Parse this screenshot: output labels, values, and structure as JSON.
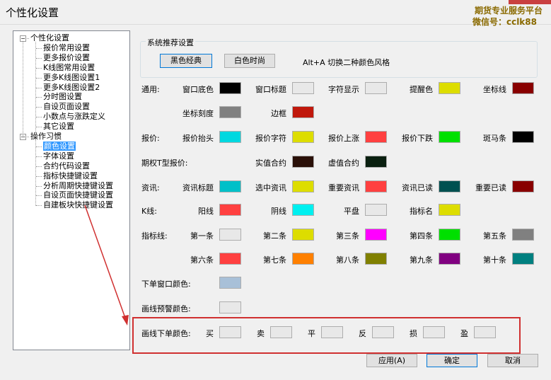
{
  "window": {
    "title": "个性化设置",
    "brand_line1": "期货专业服务平台",
    "brand_line2": "微信号：cclk88"
  },
  "tree": [
    {
      "label": "个性化设置",
      "level": 0
    },
    {
      "label": "报价常用设置",
      "level": 1
    },
    {
      "label": "更多报价设置",
      "level": 1
    },
    {
      "label": "K线图常用设置",
      "level": 1
    },
    {
      "label": "更多K线图设置1",
      "level": 1
    },
    {
      "label": "更多K线图设置2",
      "level": 1
    },
    {
      "label": "分时图设置",
      "level": 1
    },
    {
      "label": "自设页面设置",
      "level": 1
    },
    {
      "label": "小数点与涨跌定义",
      "level": 1
    },
    {
      "label": "其它设置",
      "level": 1
    },
    {
      "label": "操作习惯",
      "level": 0
    },
    {
      "label": "颜色设置",
      "level": 1,
      "selected": true
    },
    {
      "label": "字体设置",
      "level": 1
    },
    {
      "label": "合约代码设置",
      "level": 1
    },
    {
      "label": "指标快捷键设置",
      "level": 1
    },
    {
      "label": "分析周期快捷键设置",
      "level": 1
    },
    {
      "label": "自设页面快捷键设置",
      "level": 1
    },
    {
      "label": "自建板块快捷键设置",
      "level": 1
    }
  ],
  "preset": {
    "group_label": "系统推荐设置",
    "black_label": "黑色经典",
    "white_label": "白色时尚",
    "hint": "Alt+A 切换二种颜色风格"
  },
  "rows": {
    "general": {
      "label": "通用:",
      "items": [
        {
          "label": "窗口底色",
          "color": "#000000"
        },
        {
          "label": "窗口标题",
          "color": "#e8e8e8"
        },
        {
          "label": "字符显示",
          "color": "#e8e8e8"
        },
        {
          "label": "提醒色",
          "color": "#dddd00"
        },
        {
          "label": "坐标线",
          "color": "#880000"
        },
        {
          "label": "坐标刻度",
          "color": "#808080"
        },
        {
          "label": "边框",
          "color": "#c0180c"
        }
      ]
    },
    "quote": {
      "label": "报价:",
      "items": [
        {
          "label": "报价抬头",
          "color": "#00d8e0"
        },
        {
          "label": "报价字符",
          "color": "#dddd00"
        },
        {
          "label": "报价上涨",
          "color": "#ff4040"
        },
        {
          "label": "报价下跌",
          "color": "#00e000"
        },
        {
          "label": "斑马条",
          "color": "#000000"
        }
      ]
    },
    "option": {
      "label": "期权T型报价:",
      "items": [
        {
          "label": "实值合约",
          "color": "#2a1008"
        },
        {
          "label": "虚值合约",
          "color": "#0a2010"
        }
      ]
    },
    "news": {
      "label": "资讯:",
      "items": [
        {
          "label": "资讯标题",
          "color": "#00c0c8"
        },
        {
          "label": "选中资讯",
          "color": "#dddd00"
        },
        {
          "label": "重要资讯",
          "color": "#ff4040"
        },
        {
          "label": "资讯已读",
          "color": "#005050"
        },
        {
          "label": "重要已读",
          "color": "#880000"
        }
      ]
    },
    "kline": {
      "label": "K线:",
      "items": [
        {
          "label": "阳线",
          "color": "#ff4040"
        },
        {
          "label": "阴线",
          "color": "#00f0f0"
        },
        {
          "label": "平盘",
          "color": "#e8e8e8"
        },
        {
          "label": "指标名",
          "color": "#dddd00"
        }
      ]
    },
    "indicator": {
      "label": "指标线:",
      "items": [
        {
          "label": "第一条",
          "color": "#e8e8e8"
        },
        {
          "label": "第二条",
          "color": "#dddd00"
        },
        {
          "label": "第三条",
          "color": "#ff00ff"
        },
        {
          "label": "第四条",
          "color": "#00e000"
        },
        {
          "label": "第五条",
          "color": "#808080"
        },
        {
          "label": "第六条",
          "color": "#ff4040"
        },
        {
          "label": "第七条",
          "color": "#ff8000"
        },
        {
          "label": "第八条",
          "color": "#808000"
        },
        {
          "label": "第九条",
          "color": "#800080"
        },
        {
          "label": "第十条",
          "color": "#008080"
        }
      ]
    },
    "order_window": {
      "label": "下单窗口颜色:",
      "color": "#a8c0d8"
    },
    "warn_line": {
      "label": "画线预警颜色:",
      "color": "#e8e8e8"
    },
    "draw_order": {
      "label": "画线下单颜色:",
      "items": [
        {
          "label": "买",
          "color": "#e8e8e8"
        },
        {
          "label": "卖",
          "color": "#e8e8e8"
        },
        {
          "label": "平",
          "color": "#e8e8e8"
        },
        {
          "label": "反",
          "color": "#e8e8e8"
        },
        {
          "label": "损",
          "color": "#e8e8e8"
        },
        {
          "label": "盈",
          "color": "#e8e8e8"
        }
      ]
    }
  },
  "buttons": {
    "apply": "应用(A)",
    "ok": "确定",
    "cancel": "取消"
  }
}
